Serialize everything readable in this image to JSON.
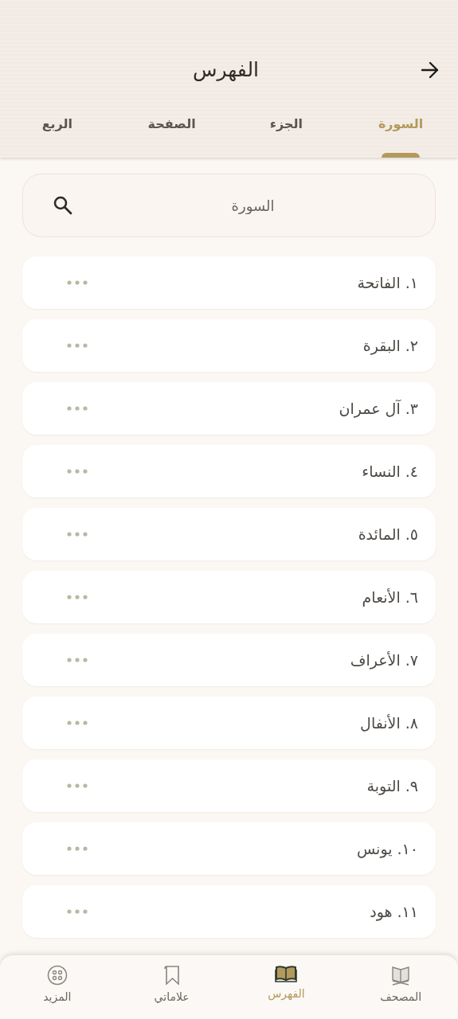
{
  "header": {
    "title": "الفهرس"
  },
  "tabs": [
    {
      "label": "السورة",
      "selected": true
    },
    {
      "label": "الجزء",
      "selected": false
    },
    {
      "label": "الصفحة",
      "selected": false
    },
    {
      "label": "الربع",
      "selected": false
    }
  ],
  "search": {
    "placeholder": "السورة"
  },
  "surahs": [
    {
      "name": "١. الفاتحة"
    },
    {
      "name": "٢. البقرة"
    },
    {
      "name": "٣. آل عمران"
    },
    {
      "name": "٤. النساء"
    },
    {
      "name": "٥. المائدة"
    },
    {
      "name": "٦. الأنعام"
    },
    {
      "name": "٧. الأعراف"
    },
    {
      "name": "٨. الأنفال"
    },
    {
      "name": "٩. التوبة"
    },
    {
      "name": "١٠. يونس"
    },
    {
      "name": "١١. هود"
    }
  ],
  "bottom_nav": [
    {
      "kind": "mushaf",
      "label": "المصحف",
      "selected": false
    },
    {
      "kind": "index",
      "label": "الفهرس",
      "selected": true
    },
    {
      "kind": "bookmarks",
      "label": "علاماتي",
      "selected": false
    },
    {
      "kind": "more",
      "label": "المزيد",
      "selected": false
    }
  ]
}
